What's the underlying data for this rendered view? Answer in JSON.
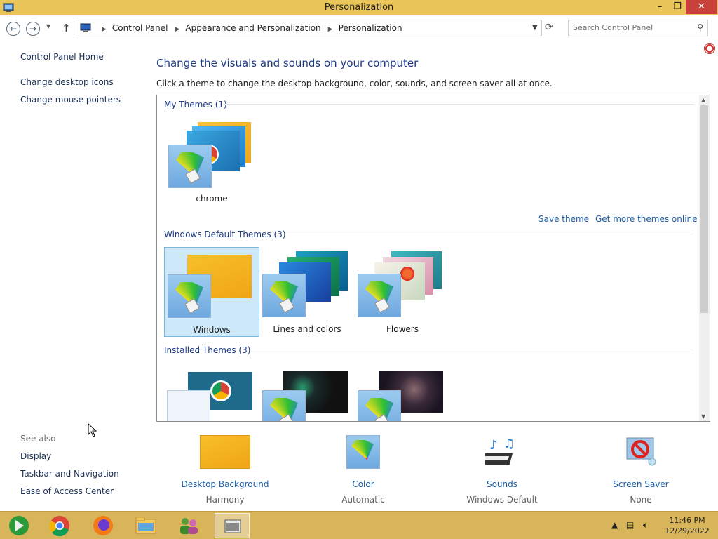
{
  "window": {
    "title": "Personalization",
    "minimize": "–",
    "maximize": "❐",
    "close": "✕"
  },
  "address": {
    "crumbs": [
      "Control Panel",
      "Appearance and Personalization",
      "Personalization"
    ],
    "search_placeholder": "Search Control Panel"
  },
  "sidebar": {
    "home": "Control Panel Home",
    "links": [
      "Change desktop icons",
      "Change mouse pointers"
    ],
    "see_also_title": "See also",
    "see_also": [
      "Display",
      "Taskbar and Navigation",
      "Ease of Access Center"
    ]
  },
  "main": {
    "title": "Change the visuals and sounds on your computer",
    "subtitle": "Click a theme to change the desktop background, color, sounds, and screen saver all at once."
  },
  "themes": {
    "my_title": "My Themes (1)",
    "my_items": [
      {
        "label": "chrome"
      }
    ],
    "save_theme": "Save theme",
    "get_more": "Get more themes online",
    "default_title": "Windows Default Themes (3)",
    "default_items": [
      {
        "label": "Windows"
      },
      {
        "label": "Lines and colors"
      },
      {
        "label": "Flowers"
      }
    ],
    "installed_title": "Installed Themes (3)"
  },
  "options": [
    {
      "label": "Desktop Background",
      "value": "Harmony"
    },
    {
      "label": "Color",
      "value": "Automatic"
    },
    {
      "label": "Sounds",
      "value": "Windows Default"
    },
    {
      "label": "Screen Saver",
      "value": "None"
    }
  ],
  "taskbar": {
    "time": "11:46 PM",
    "date": "12/29/2022"
  },
  "colors": {
    "titlebar": "#e9c55a",
    "taskbar": "#d8b45a",
    "link": "#1c5ea8",
    "heading": "#1c3a84"
  }
}
